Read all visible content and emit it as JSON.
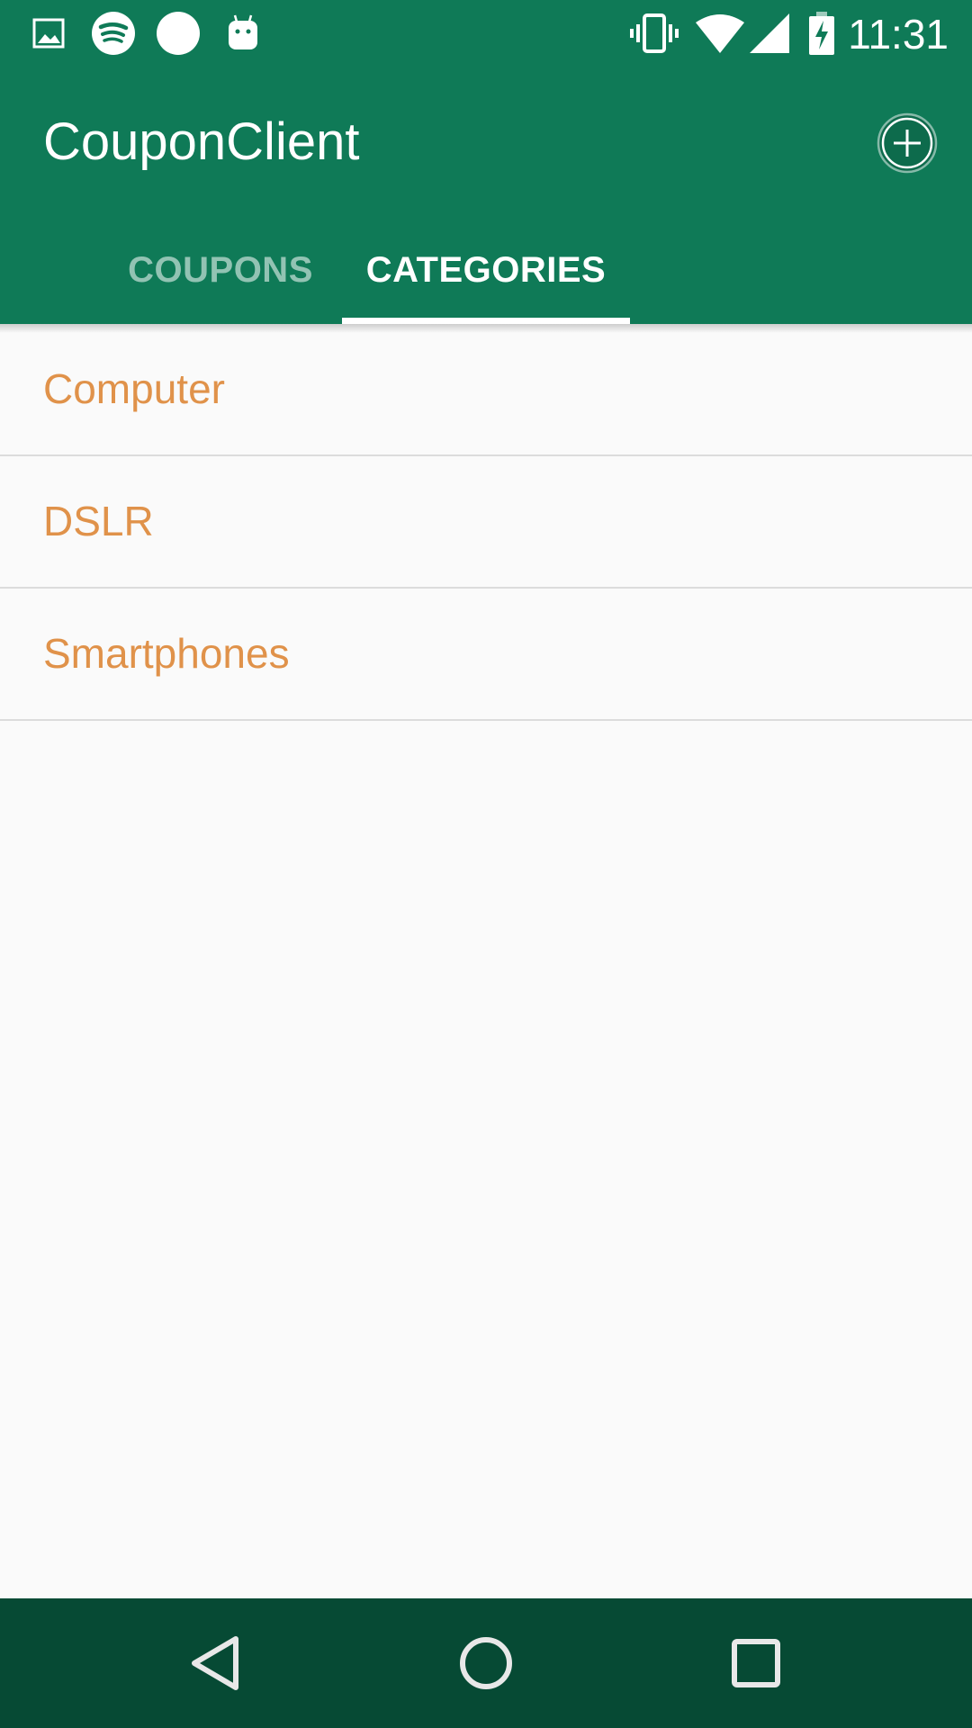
{
  "status_bar": {
    "time": "11:31",
    "left_icons": [
      "image-icon",
      "spotify-icon",
      "circle-notification-icon",
      "android-icon"
    ],
    "right_icons": [
      "vibrate-icon",
      "wifi-icon",
      "cell-signal-icon",
      "battery-charging-icon"
    ]
  },
  "app_bar": {
    "title": "CouponClient",
    "add_icon": "add-circle-icon",
    "color": "#0F7A57"
  },
  "tabs": [
    {
      "label": "COUPONS",
      "selected": false
    },
    {
      "label": "CATEGORIES",
      "selected": true
    }
  ],
  "categories": [
    {
      "label": "Computer"
    },
    {
      "label": "DSLR"
    },
    {
      "label": "Smartphones"
    }
  ],
  "colors": {
    "accent_text": "#E0924A",
    "nav_bar": "#064A34",
    "background": "#FAFAFA"
  },
  "nav_bar": {
    "buttons": [
      "back-icon",
      "home-icon",
      "recents-icon"
    ]
  }
}
